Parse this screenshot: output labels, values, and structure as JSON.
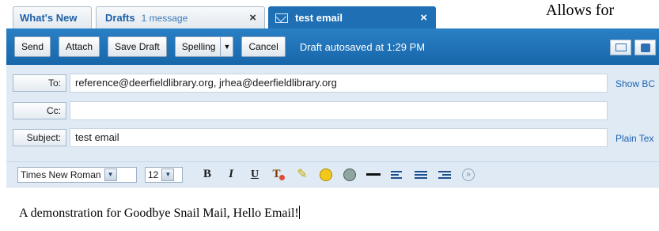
{
  "tabs": [
    {
      "label": "What's New"
    },
    {
      "label": "Drafts",
      "sub": "1 message",
      "close": "×"
    },
    {
      "label": "test email",
      "close": "×",
      "active": true
    }
  ],
  "overlay_text": "Allows for",
  "toolbar": {
    "send": "Send",
    "attach": "Attach",
    "save_draft": "Save Draft",
    "spelling": "Spelling",
    "cancel": "Cancel",
    "status": "Draft autosaved at 1:29 PM"
  },
  "fields": {
    "to_label": "To:",
    "to_value": "reference@deerfieldlibrary.org, jrhea@deerfieldlibrary.org",
    "show_bc": "Show BC",
    "cc_label": "Cc:",
    "cc_value": "",
    "subject_label": "Subject:",
    "subject_value": "test email",
    "plain_text": "Plain Tex"
  },
  "format": {
    "font": "Times New Roman",
    "size": "12",
    "bold": "B",
    "italic": "I",
    "underline": "U"
  },
  "editor": {
    "body": "A demonstration for Goodbye Snail Mail, Hello Email!"
  },
  "colors": {
    "accent": "#1f6fb4",
    "header_bg": "#dfeaf5",
    "link": "#1e63b0"
  },
  "icons": [
    "envelope-icon",
    "close-icon",
    "dropdown-arrow-icon",
    "text-color-icon",
    "highlight-icon",
    "emoticon-icon",
    "image-icon",
    "horizontal-rule-icon",
    "align-icon",
    "list-icon",
    "indent-icon",
    "more-options-icon",
    "message-view-icon",
    "comment-view-icon"
  ]
}
